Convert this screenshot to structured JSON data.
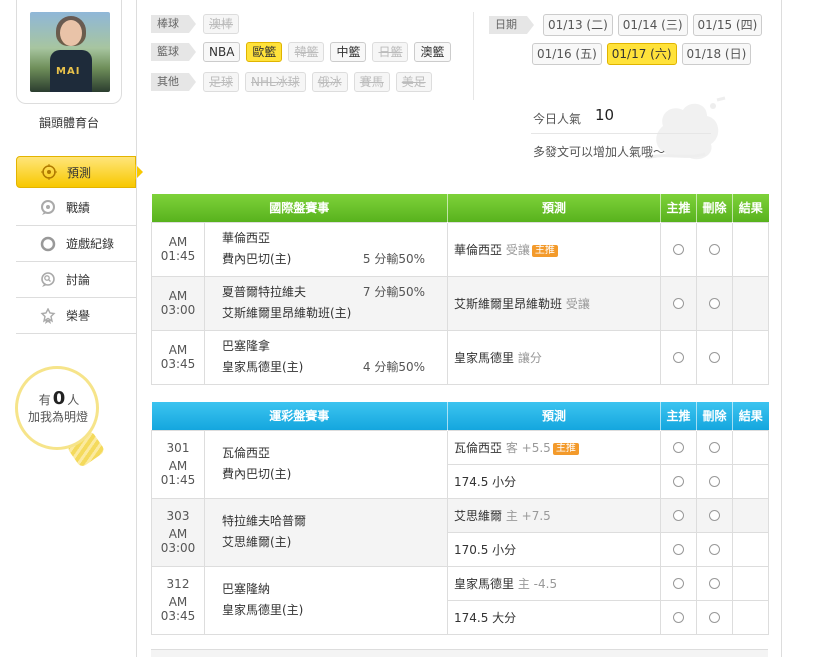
{
  "profile": {
    "nickname": "韻頭體育台"
  },
  "nav": [
    {
      "label": "預測",
      "icon": "target-icon",
      "active": true
    },
    {
      "label": "戰績",
      "icon": "chat-icon",
      "active": false
    },
    {
      "label": "遊戲紀錄",
      "icon": "circle-icon",
      "active": false
    },
    {
      "label": "討論",
      "icon": "search-chat-icon",
      "active": false
    },
    {
      "label": "榮譽",
      "icon": "medal-icon",
      "active": false
    }
  ],
  "bulb": {
    "prefix": "有",
    "count": "0",
    "suffix": "人",
    "line2": "加我為明燈"
  },
  "filters": {
    "baseball": {
      "label": "棒球",
      "items": [
        {
          "label": "澳棒",
          "state": "disabled"
        }
      ]
    },
    "basketball": {
      "label": "籃球",
      "items": [
        {
          "label": "NBA",
          "state": "normal"
        },
        {
          "label": "歐籃",
          "state": "active"
        },
        {
          "label": "韓籃",
          "state": "disabled"
        },
        {
          "label": "中籃",
          "state": "normal"
        },
        {
          "label": "日籃",
          "state": "disabled"
        },
        {
          "label": "澳籃",
          "state": "normal"
        }
      ]
    },
    "other": {
      "label": "其他",
      "items": [
        {
          "label": "足球",
          "state": "disabled"
        },
        {
          "label": "NHL冰球",
          "state": "disabled"
        },
        {
          "label": "俄冰",
          "state": "disabled"
        },
        {
          "label": "賽馬",
          "state": "disabled"
        },
        {
          "label": "美足",
          "state": "disabled"
        }
      ]
    }
  },
  "dates": {
    "label": "日期",
    "row1": [
      {
        "label": "01/13 (二)",
        "active": false
      },
      {
        "label": "01/14 (三)",
        "active": false
      },
      {
        "label": "01/15 (四)",
        "active": false
      }
    ],
    "row2": [
      {
        "label": "01/16 (五)",
        "active": false
      },
      {
        "label": "01/17 (六)",
        "active": true
      },
      {
        "label": "01/18 (日)",
        "active": false
      }
    ]
  },
  "popularity": {
    "label": "今日人氣",
    "value": "10",
    "hint": "多發文可以增加人氣哦～"
  },
  "intl_table": {
    "headers": {
      "game": "國際盤賽事",
      "predict": "預測",
      "main": "主推",
      "delete": "刪除",
      "result": "結果"
    },
    "rows": [
      {
        "time": "AM 01:45",
        "team1": "華倫西亞",
        "team2": "費內巴切(主)",
        "odds": "5 分輸50%",
        "odds_line": 2,
        "pred_team": "華倫西亞",
        "pred_type": "受讓",
        "badge": "主推"
      },
      {
        "time": "AM 03:00",
        "team1": "夏普爾特拉維夫",
        "team2": "艾斯維爾里昂維勒班(主)",
        "odds": "7 分輸50%",
        "odds_line": 1,
        "pred_team": "艾斯維爾里昂維勒班",
        "pred_type": "受讓",
        "badge": ""
      },
      {
        "time": "AM 03:45",
        "team1": "巴塞隆拿",
        "team2": "皇家馬德里(主)",
        "odds": "4 分輸50%",
        "odds_line": 2,
        "pred_team": "皇家馬德里",
        "pred_type": "讓分",
        "badge": ""
      }
    ]
  },
  "sport_table": {
    "headers": {
      "game": "運彩盤賽事",
      "predict": "預測",
      "main": "主推",
      "delete": "刪除",
      "result": "結果"
    },
    "rows": [
      {
        "num": "301",
        "time": "AM 01:45",
        "team1": "瓦倫西亞",
        "team2": "費內巴切(主)",
        "pred1": {
          "team": "瓦倫西亞",
          "extra": "客 +5.5",
          "badge": "主推"
        },
        "pred2": {
          "team": "174.5 小分",
          "extra": "",
          "badge": ""
        }
      },
      {
        "num": "303",
        "time": "AM 03:00",
        "team1": "特拉維夫哈普爾",
        "team2": "艾思維爾(主)",
        "pred1": {
          "team": "艾思維爾",
          "extra": "主 +7.5",
          "badge": ""
        },
        "pred2": {
          "team": "170.5 小分",
          "extra": "",
          "badge": ""
        }
      },
      {
        "num": "312",
        "time": "AM 03:45",
        "team1": "巴塞隆納",
        "team2": "皇家馬德里(主)",
        "pred1": {
          "team": "皇家馬德里",
          "extra": "主 -4.5",
          "badge": ""
        },
        "pred2": {
          "team": "174.5 大分",
          "extra": "",
          "badge": ""
        }
      }
    ]
  }
}
